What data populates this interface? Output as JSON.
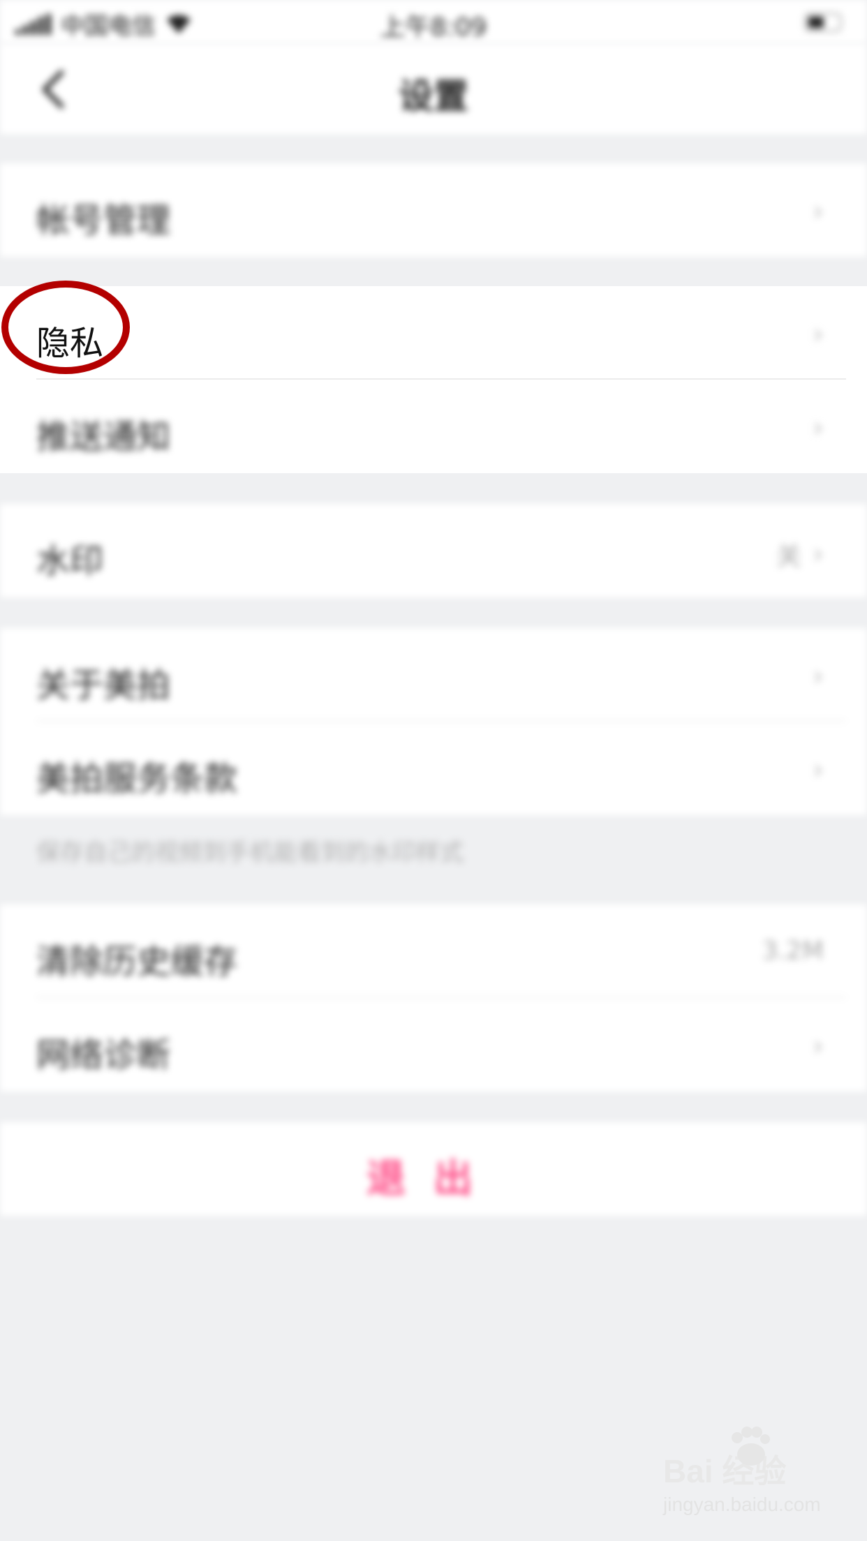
{
  "status_bar": {
    "carrier": "中国电信",
    "time": "上午8:09"
  },
  "nav": {
    "title": "设置",
    "back_icon": "back-chevron-icon"
  },
  "sections": [
    {
      "rows": [
        {
          "label": "帐号管理",
          "value": "",
          "chevron": true
        }
      ]
    },
    {
      "rows": [
        {
          "label": "隐私",
          "value": "",
          "chevron": true
        },
        {
          "label": "推送通知",
          "value": "",
          "chevron": true
        }
      ]
    },
    {
      "rows": [
        {
          "label": "水印",
          "value": "关",
          "chevron": true
        }
      ]
    },
    {
      "rows": [
        {
          "label": "关于美拍",
          "value": "",
          "chevron": true
        },
        {
          "label": "美拍服务条款",
          "value": "",
          "chevron": true
        }
      ]
    },
    {
      "rows": [
        {
          "label": "清除历史缓存",
          "value": "3.2M",
          "chevron": false
        },
        {
          "label": "网络诊断",
          "value": "",
          "chevron": true
        }
      ]
    }
  ],
  "hint_text": "保存自己的视频到手机能看到的水印样式",
  "logout_label": "退出",
  "highlight": {
    "color": "#b30000",
    "target": "隐私"
  },
  "colors": {
    "accent": "#ff4d88",
    "background": "#eff0f2"
  },
  "watermark": {
    "logo": "Bai 经验",
    "url": "jingyan.baidu.com"
  },
  "chevron_glyph": "›"
}
